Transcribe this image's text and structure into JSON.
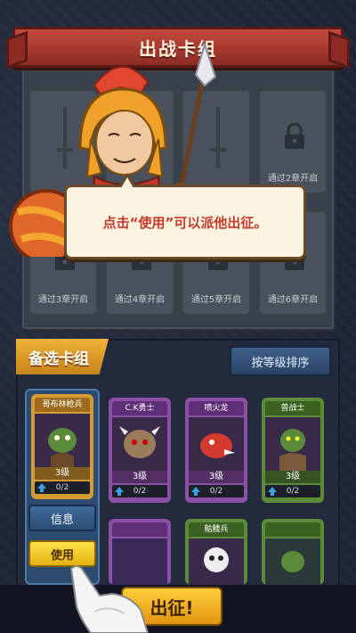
{
  "header": {
    "title": "出战卡组"
  },
  "deck_slots": [
    {
      "type": "empty",
      "label": ""
    },
    {
      "type": "empty",
      "label": ""
    },
    {
      "type": "empty",
      "label": ""
    },
    {
      "type": "locked",
      "label": "通过2章开启"
    },
    {
      "type": "locked",
      "label": "通过3章开启"
    },
    {
      "type": "locked",
      "label": "通过4章开启"
    },
    {
      "type": "locked",
      "label": "通过5章开启"
    },
    {
      "type": "locked",
      "label": "通过6章开启"
    }
  ],
  "tooltip": {
    "text": "点击“使用”可以派他出征。"
  },
  "reserve": {
    "title": "备选卡组",
    "sort_label": "按等级排序",
    "cards": [
      {
        "name": "哥布林枪兵",
        "level": "3级",
        "progress": "0/2",
        "frame": "#d49a33",
        "header": "#9e6b1d"
      },
      {
        "name": "C.K勇士",
        "level": "3级",
        "progress": "0/2",
        "frame": "#8b4fa8",
        "header": "#5e2f75"
      },
      {
        "name": "喷火龙",
        "level": "3级",
        "progress": "0/2",
        "frame": "#8b4fa8",
        "header": "#5e2f75"
      },
      {
        "name": "兽战士",
        "level": "3级",
        "progress": "0/2",
        "frame": "#5a8a3a",
        "header": "#3b6121"
      },
      {
        "name": "",
        "level": "",
        "progress": "",
        "frame": "#8b4fa8",
        "header": "#5e2f75"
      },
      {
        "name": "骷髅兵",
        "level": "",
        "progress": "",
        "frame": "#5a8a3a",
        "header": "#3b6121"
      },
      {
        "name": "",
        "level": "",
        "progress": "",
        "frame": "#5a8a3a",
        "header": "#3b6121"
      }
    ],
    "info_label": "信息",
    "use_label": "使用"
  },
  "deploy_label": "出征!"
}
